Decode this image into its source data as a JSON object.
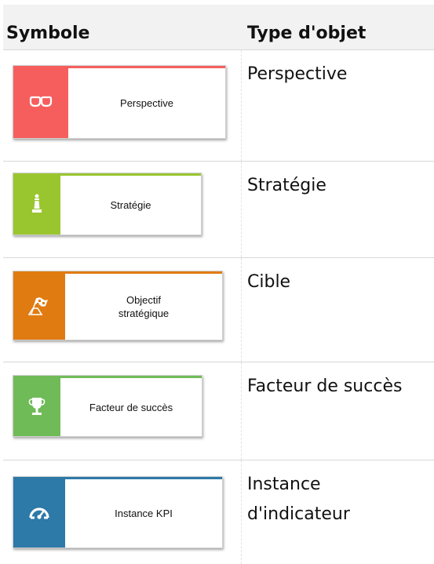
{
  "header": {
    "symbol_col": "Symbole",
    "type_col": "Type d'objet"
  },
  "rows": [
    {
      "symbol_label": "Perspective",
      "type": "Perspective",
      "color": "#f65e5e",
      "icon": "glasses-icon"
    },
    {
      "symbol_label": "Stratégie",
      "type": "Stratégie",
      "color": "#99c62e",
      "icon": "chess-piece-icon"
    },
    {
      "symbol_label": "Objectif stratégique",
      "type": "Cible",
      "color": "#e07b12",
      "icon": "finish-flag-icon"
    },
    {
      "symbol_label": "Facteur de succès",
      "type": "Facteur de succès",
      "color": "#6fbb57",
      "icon": "trophy-icon"
    },
    {
      "symbol_label": "Instance KPI",
      "type_line1": "Instance",
      "type_line2": "d'indicateur",
      "color": "#2d79a8",
      "icon": "gauge-icon"
    }
  ]
}
